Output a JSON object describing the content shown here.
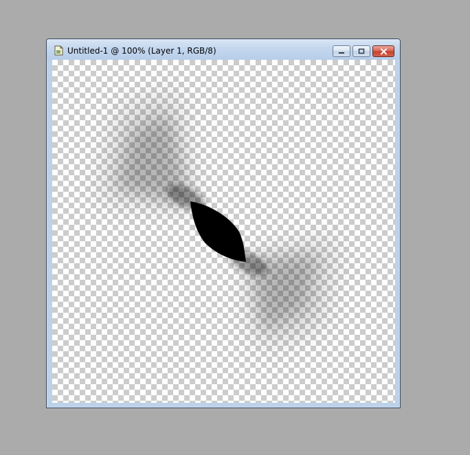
{
  "window": {
    "title": "Untitled-1 @ 100% (Layer 1, RGB/8)",
    "icon": "document-icon",
    "buttons": {
      "minimize": "minimize-icon",
      "maximize": "maximize-icon",
      "close": "close-icon"
    }
  },
  "colors": {
    "desktop": "#ababab",
    "checker_light": "#ffffff",
    "checker_dark": "#cccccc",
    "paint": "#000000",
    "close_button": "#c5402d"
  }
}
